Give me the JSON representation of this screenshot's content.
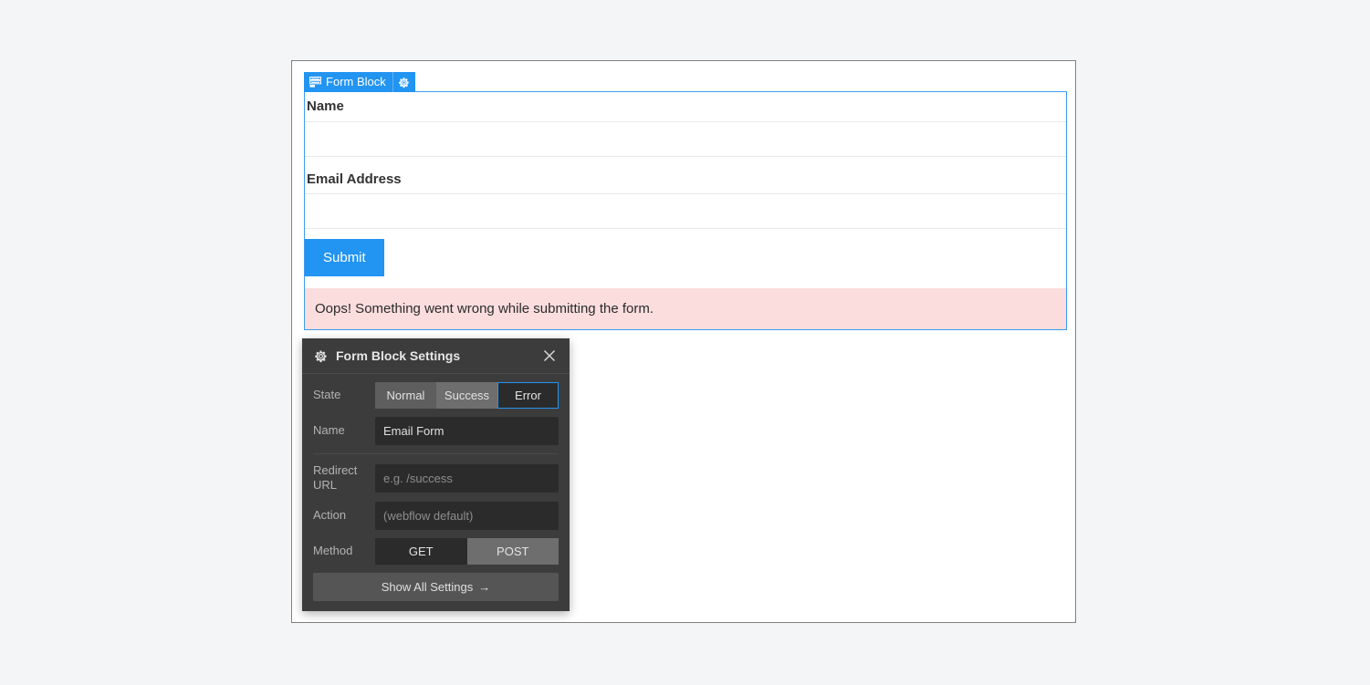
{
  "canvas": {
    "block_tab": {
      "label": "Form Block",
      "form_icon": "form-icon",
      "gear_icon": "gear-icon"
    },
    "form": {
      "fields": [
        {
          "label": "Name",
          "value": "",
          "name": "name-field"
        },
        {
          "label": "Email Address",
          "value": "",
          "name": "email-field"
        }
      ],
      "submit_label": "Submit",
      "error_message": "Oops! Something went wrong while submitting the form."
    }
  },
  "settings_panel": {
    "gear_icon": "gear-icon",
    "title": "Form Block Settings",
    "close_icon": "close-icon",
    "state": {
      "label": "State",
      "options": [
        "Normal",
        "Success",
        "Error"
      ],
      "selected": "Error"
    },
    "name": {
      "label": "Name",
      "value": "Email Form",
      "placeholder": ""
    },
    "redirect_url": {
      "label": "Redirect URL",
      "value": "",
      "placeholder": "e.g. /success"
    },
    "action": {
      "label": "Action",
      "value": "",
      "placeholder": "(webflow default)"
    },
    "method": {
      "label": "Method",
      "options": [
        "GET",
        "POST"
      ],
      "selected": "GET"
    },
    "show_all_label": "Show All Settings",
    "show_all_arrow": "→"
  },
  "colors": {
    "accent_blue": "#2294f2",
    "error_bg": "#fbdddd",
    "panel_bg": "#3c3c3c",
    "page_bg": "#f4f5f7"
  }
}
